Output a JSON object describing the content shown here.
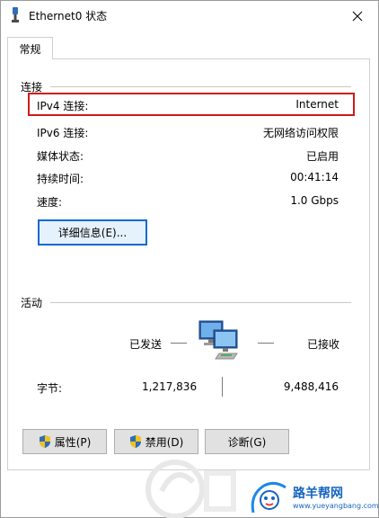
{
  "window": {
    "title": "Ethernet0 状态"
  },
  "tabs": [
    {
      "label": "常规"
    }
  ],
  "connection": {
    "section_label": "连接",
    "rows": [
      {
        "label": "IPv4 连接:",
        "value": "Internet"
      },
      {
        "label": "IPv6 连接:",
        "value": "无网络访问权限"
      },
      {
        "label": "媒体状态:",
        "value": "已启用"
      },
      {
        "label": "持续时间:",
        "value": "00:41:14"
      },
      {
        "label": "速度:",
        "value": "1.0 Gbps"
      }
    ],
    "details_button": "详细信息(E)..."
  },
  "activity": {
    "section_label": "活动",
    "sent_label": "已发送",
    "received_label": "已接收",
    "bytes_label": "字节:",
    "bytes_sent": "1,217,836",
    "bytes_received": "9,488,416"
  },
  "buttons": {
    "properties": "属性(P)",
    "disable": "禁用(D)",
    "diagnose": "诊断(G)"
  },
  "watermark": {
    "site_name": "路羊帮网",
    "site_url": "www.yueyangbang.com"
  },
  "colors": {
    "highlight_border": "#cc1b1b",
    "focus_border": "#0a6ad1",
    "watermark_blue": "#1565c0"
  }
}
